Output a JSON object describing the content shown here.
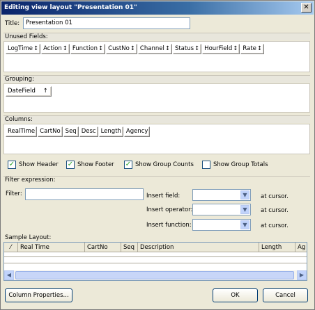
{
  "window": {
    "title": "Editing view layout \"Presentation 01\"",
    "close_symbol": "✕"
  },
  "title_field": {
    "label": "Title:",
    "value": "Presentation 01"
  },
  "unused_fields": {
    "header": "Unused Fields:",
    "items": [
      "LogTime",
      "Action",
      "Function",
      "CustNo",
      "Channel",
      "Status",
      "HourField",
      "Rate"
    ],
    "sort_symbol": "↕"
  },
  "grouping": {
    "header": "Grouping:",
    "items": [
      {
        "label": "DateField",
        "arrow": "↑"
      }
    ]
  },
  "columns": {
    "header": "Columns:",
    "items": [
      "RealTime",
      "CartNo",
      "Seq",
      "Desc",
      "Length",
      "Agency"
    ]
  },
  "options": {
    "show_header": {
      "label": "Show Header",
      "checked": true
    },
    "show_footer": {
      "label": "Show Footer",
      "checked": true
    },
    "show_group_counts": {
      "label": "Show Group Counts",
      "checked": true
    },
    "show_group_totals": {
      "label": "Show Group Totals",
      "checked": false
    },
    "check_mark": "✓"
  },
  "filter": {
    "header": "Filter expression:",
    "label": "Filter:",
    "value": "",
    "insert_field_label": "Insert field:",
    "insert_operator_label": "Insert operator:",
    "insert_function_label": "Insert function:",
    "at_cursor": "at cursor.",
    "dropdown_symbol": "▼"
  },
  "sample_layout": {
    "header": "Sample Layout:",
    "corner_symbol": "⁄",
    "columns": [
      "Real Time",
      "CartNo",
      "Seq",
      "Description",
      "Length",
      "Ag"
    ],
    "scroll_left": "◀",
    "scroll_right": "▶"
  },
  "buttons": {
    "column_properties": "Column Properties...",
    "ok": "OK",
    "cancel": "Cancel"
  }
}
